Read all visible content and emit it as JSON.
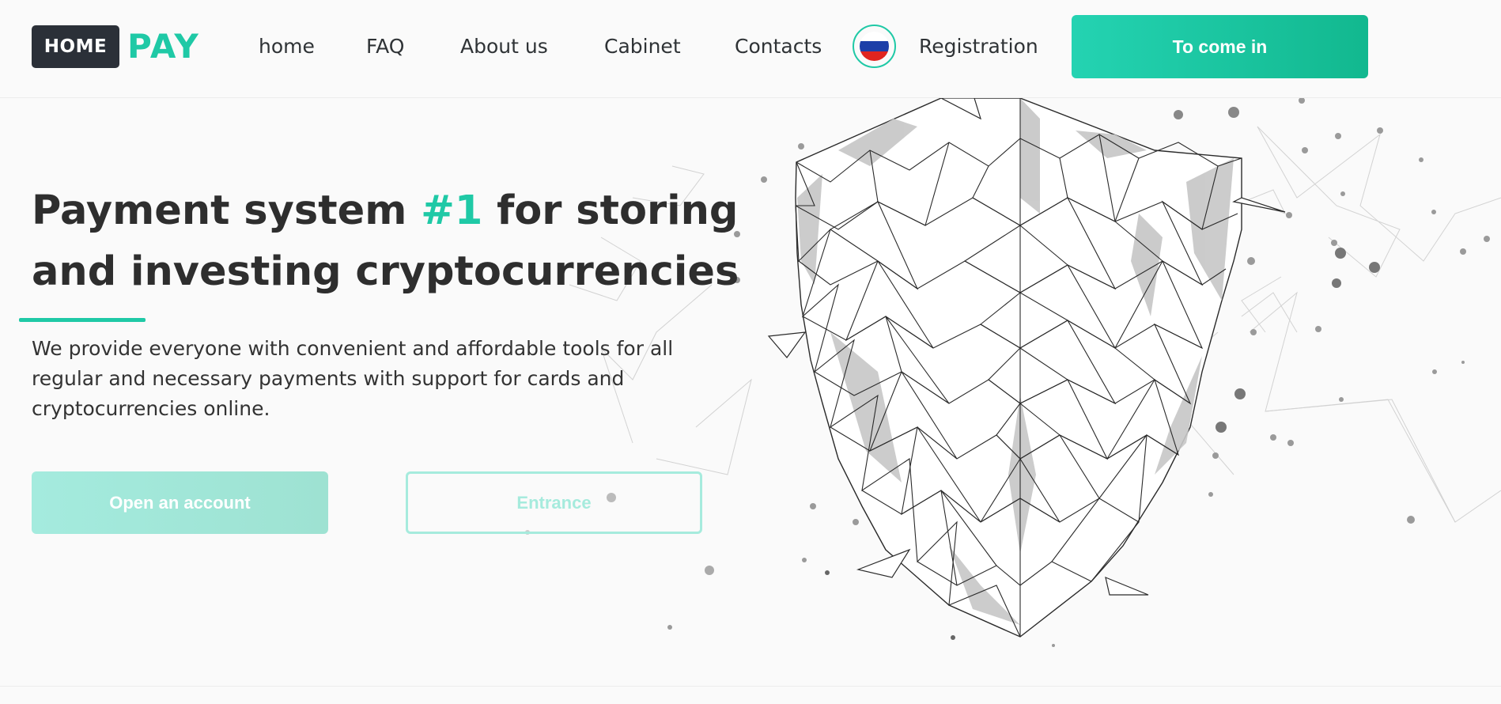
{
  "logo": {
    "home": "HOME",
    "pay": "PAY"
  },
  "nav": {
    "items": [
      {
        "label": "home"
      },
      {
        "label": "FAQ"
      },
      {
        "label": "About us"
      },
      {
        "label": "Cabinet"
      },
      {
        "label": "Contacts"
      }
    ],
    "registration": "Registration",
    "login_button": "To come in",
    "language_flag": "russia-flag-icon"
  },
  "hero": {
    "title_part1": "Payment system ",
    "title_accent": "#1",
    "title_part2": " for storing and investing cryptocurrencies",
    "description": "We provide everyone with convenient and affordable tools for all regular and necessary payments with support for cards and cryptocurrencies online.",
    "open_account_button": "Open an account",
    "entrance_button": "Entrance"
  },
  "illustration": {
    "icon": "polygon-shield-icon"
  },
  "colors": {
    "accent": "#1fc9a6",
    "dark": "#2b3038",
    "text": "#2e2e2e",
    "background": "#fafafa"
  }
}
